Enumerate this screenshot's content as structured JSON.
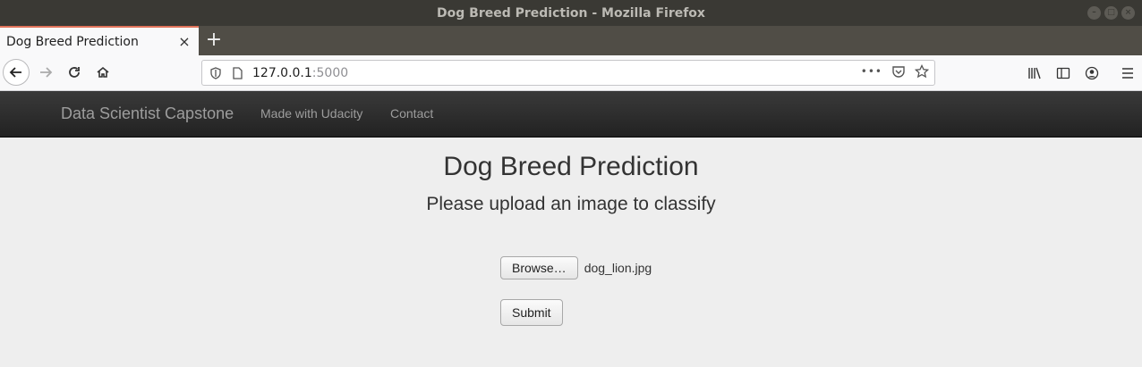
{
  "window": {
    "title": "Dog Breed Prediction - Mozilla Firefox"
  },
  "tab": {
    "title": "Dog Breed Prediction",
    "close": "×",
    "new": "+"
  },
  "urlbar": {
    "host": "127.0.0.1",
    "port": ":5000",
    "more": "•••"
  },
  "icons": {
    "back": "back-arrow-icon",
    "forward": "forward-arrow-icon",
    "reload": "reload-icon",
    "home": "home-icon",
    "shield": "tracking-shield-icon",
    "page": "page-info-icon",
    "pocket": "pocket-icon",
    "bookmark": "star-icon",
    "library": "library-icon",
    "sidebar": "sidebar-icon",
    "account": "account-icon",
    "menu": "hamburger-menu-icon"
  },
  "appnav": {
    "brand": "Data Scientist Capstone",
    "links": [
      "Made with Udacity",
      "Contact"
    ]
  },
  "main": {
    "heading": "Dog Breed Prediction",
    "subheading": "Please upload an image to classify",
    "browse_label": "Browse…",
    "file_name": "dog_lion.jpg",
    "submit_label": "Submit"
  },
  "colors": {
    "navbar_bg": "#222222",
    "page_bg": "#eeeeee",
    "tab_accent": "#e0735a"
  }
}
